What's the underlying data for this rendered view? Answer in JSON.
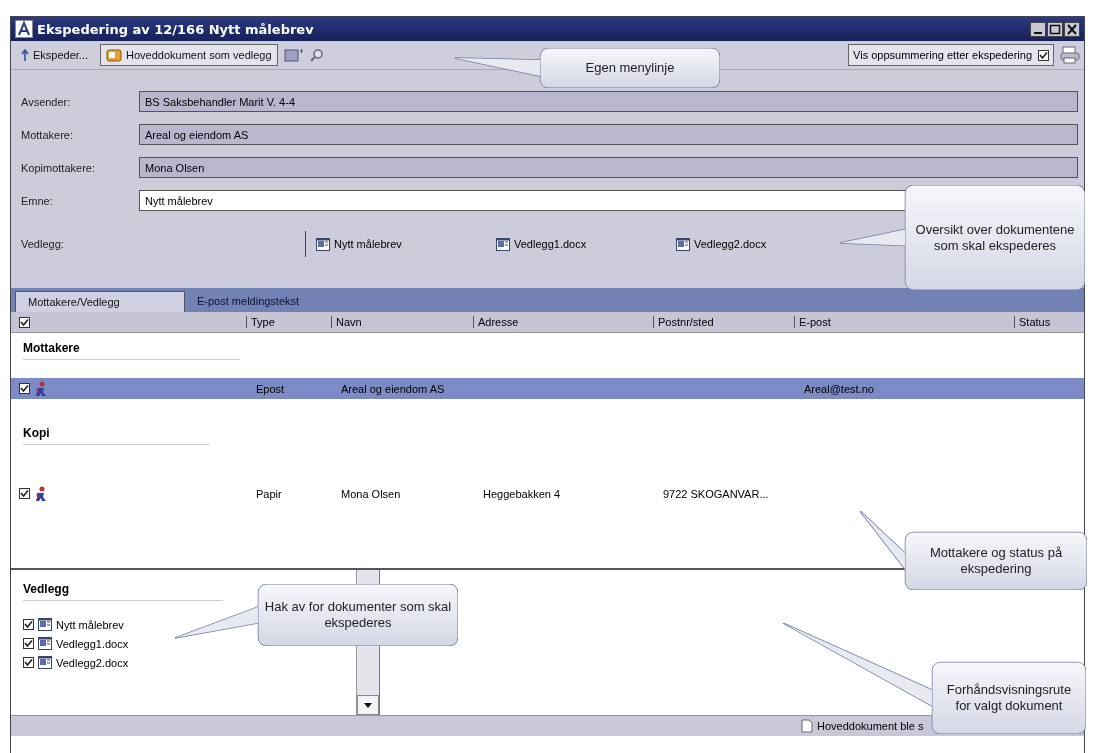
{
  "window": {
    "title": "Ekspedering av 12/166 Nytt målebrev"
  },
  "toolbar": {
    "buttons": [
      {
        "label": "Ekspeder...",
        "kind": "plain"
      },
      {
        "label": "Hoveddokument som vedlegg",
        "kind": "framed"
      }
    ],
    "summary_option": {
      "label": "Vis oppsummering etter ekspedering",
      "checked": true
    }
  },
  "form": {
    "fields": [
      {
        "label": "Avsender:",
        "value": "BS Saksbehandler Marit V.  4-4",
        "editable": false
      },
      {
        "label": "Mottakere:",
        "value": "Areal og eiendom AS",
        "editable": false
      },
      {
        "label": "Kopimottakere:",
        "value": "Mona Olsen",
        "editable": false
      },
      {
        "label": "Emne:",
        "value": "Nytt målebrev",
        "editable": true
      }
    ],
    "attachments_label": "Vedlegg:",
    "attachments": [
      "Nytt målebrev",
      "Vedlegg1.docx",
      "Vedlegg2.docx"
    ]
  },
  "tabs": [
    {
      "label": "Mottakere/Vedlegg",
      "selected": true
    },
    {
      "label": "E-post meldingstekst",
      "selected": false
    }
  ],
  "table": {
    "all_checked": true,
    "columns": [
      "Type",
      "Navn",
      "Adresse",
      "Postnr/sted",
      "E-post",
      "Status"
    ],
    "groups": [
      {
        "title": "Mottakere",
        "rows": [
          {
            "checked": true,
            "selected": true,
            "type": "Epost",
            "name": "Areal og eiendom AS",
            "email": "Areal@test.no"
          }
        ]
      },
      {
        "title": "Kopi",
        "rows": [
          {
            "checked": true,
            "selected": false,
            "type": "Papir",
            "name": "Mona Olsen",
            "address": "Heggebakken 4",
            "postal": "9722 SKOGANVAR..."
          }
        ]
      }
    ]
  },
  "attachments_panel": {
    "title": "Vedlegg",
    "items": [
      {
        "name": "Nytt målebrev",
        "checked": true
      },
      {
        "name": "Vedlegg1.docx",
        "checked": true
      },
      {
        "name": "Vedlegg2.docx",
        "checked": true
      }
    ]
  },
  "status_bar": {
    "text": "Hoveddokument ble s"
  },
  "callouts": [
    {
      "text": "Egen menylinje"
    },
    {
      "text": "Oversikt over dokumentene som skal ekspederes"
    },
    {
      "text": "Mottakere og status på ekspedering"
    },
    {
      "text": "Hak av for dokumenter som skal ekspederes"
    },
    {
      "text": "Forhåndsvisningsrute for valgt dokument"
    }
  ]
}
